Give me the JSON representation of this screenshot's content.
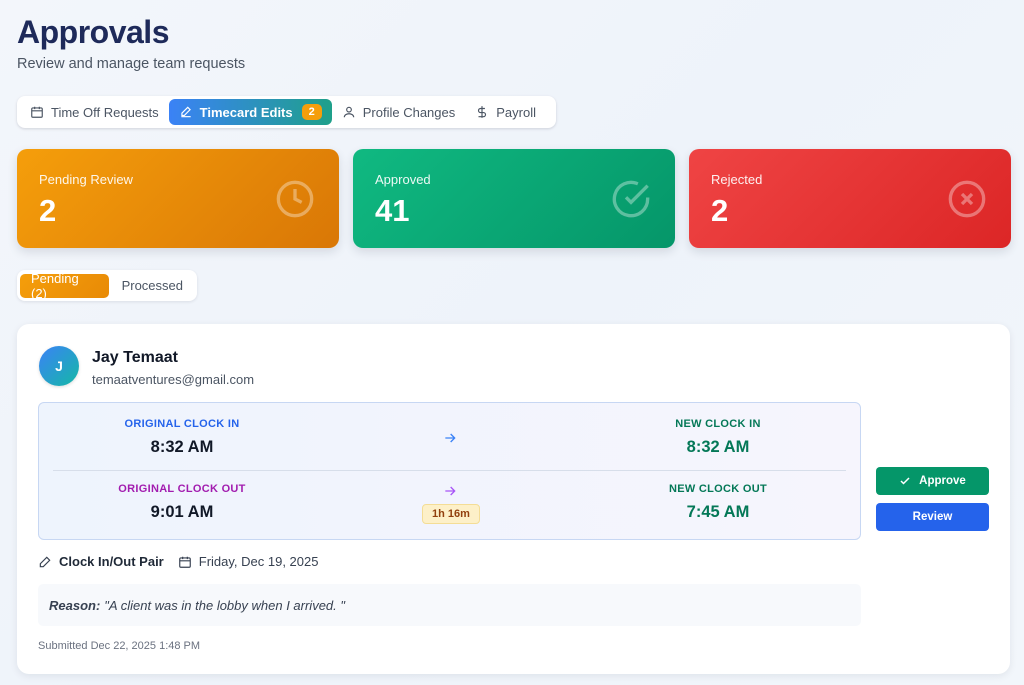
{
  "header": {
    "title": "Approvals",
    "subtitle": "Review and manage team requests"
  },
  "tabs": [
    {
      "label": "Time Off Requests",
      "icon": "calendar-icon"
    },
    {
      "label": "Timecard Edits",
      "icon": "pencil-icon",
      "count": "2",
      "active": true
    },
    {
      "label": "Profile Changes",
      "icon": "user-icon"
    },
    {
      "label": "Payroll",
      "icon": "dollar-icon"
    }
  ],
  "stats": {
    "pending": {
      "label": "Pending Review",
      "value": "2",
      "icon": "clock-icon",
      "color": "#f59e0b"
    },
    "approved": {
      "label": "Approved",
      "value": "41",
      "icon": "check-circle-icon",
      "color": "#10b981"
    },
    "rejected": {
      "label": "Rejected",
      "value": "2",
      "icon": "x-circle-icon",
      "color": "#ef4444"
    }
  },
  "filter": {
    "pending_label": "Pending (2)",
    "processed_label": "Processed"
  },
  "request": {
    "avatar_initial": "J",
    "name": "Jay Temaat",
    "email": "temaatventures@gmail.com",
    "original_clock_in_label": "ORIGINAL CLOCK IN",
    "original_clock_in": "8:32 AM",
    "new_clock_in_label": "NEW CLOCK IN",
    "new_clock_in": "8:32 AM",
    "original_clock_out_label": "ORIGINAL CLOCK OUT",
    "original_clock_out": "9:01 AM",
    "new_clock_out_label": "NEW CLOCK OUT",
    "new_clock_out": "7:45 AM",
    "duration": "1h 16m",
    "type": "Clock In/Out Pair",
    "date": "Friday, Dec 19, 2025",
    "reason_label": "Reason:",
    "reason_text": "\"A client was in the lobby when I arrived. \"",
    "submitted": "Submitted Dec 22, 2025 1:48 PM",
    "approve_label": "Approve",
    "review_label": "Review"
  },
  "colors": {
    "in_label": "#2563eb",
    "out_label": "#a21caf",
    "new_label": "#047857",
    "new_time": "#047857"
  }
}
